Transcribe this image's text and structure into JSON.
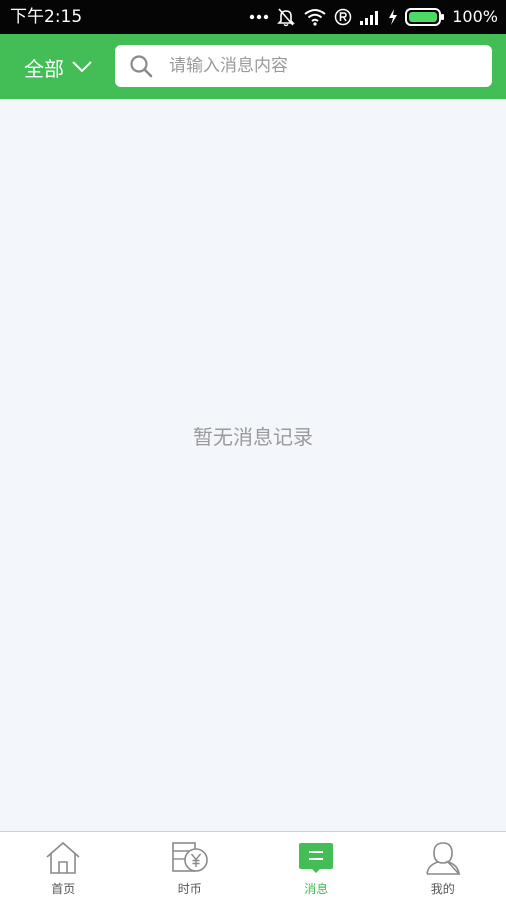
{
  "status_bar": {
    "time": "下午2:15",
    "battery_text": "100%",
    "icons": [
      "more-dots-icon",
      "bell-muted-icon",
      "wifi-icon",
      "registered-icon",
      "signal-icon",
      "charging-icon",
      "battery-icon"
    ]
  },
  "header": {
    "filter_label": "全部",
    "search": {
      "placeholder": "请输入消息内容",
      "value": ""
    },
    "accent_color": "#43bd56"
  },
  "main": {
    "empty_text": "暂无消息记录"
  },
  "tabbar": {
    "items": [
      {
        "label": "首页",
        "icon": "home-icon",
        "active": false
      },
      {
        "label": "时币",
        "icon": "coin-wallet-icon",
        "active": false
      },
      {
        "label": "消息",
        "icon": "message-icon",
        "active": true
      },
      {
        "label": "我的",
        "icon": "user-icon",
        "active": false
      }
    ]
  }
}
